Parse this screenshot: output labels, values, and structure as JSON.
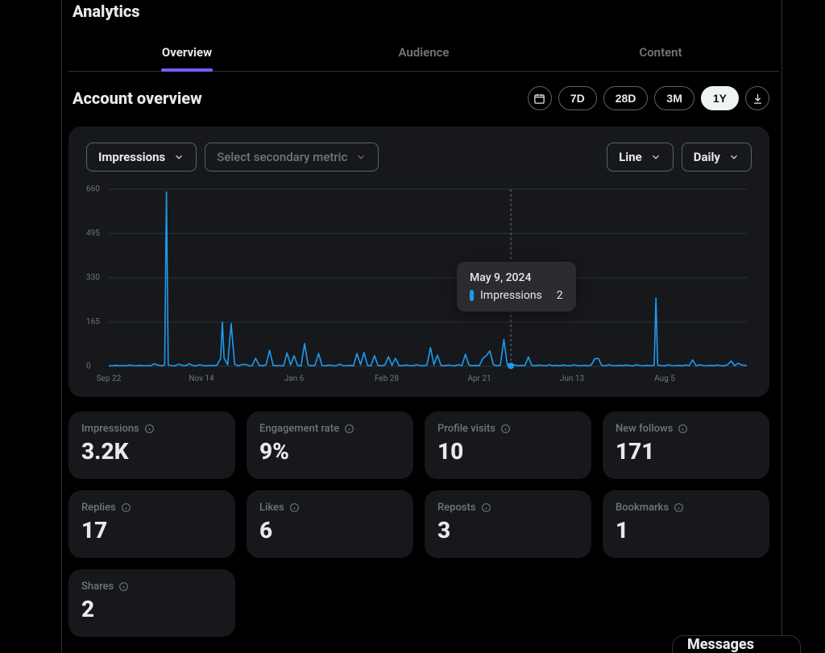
{
  "page_title": "Analytics",
  "tabs": {
    "overview": "Overview",
    "audience": "Audience",
    "content": "Content",
    "active": "overview"
  },
  "section_title": "Account overview",
  "date_ranges": [
    "7D",
    "28D",
    "3M",
    "1Y"
  ],
  "date_range_active": "1Y",
  "metric_selector": {
    "label": "Impressions"
  },
  "secondary_selector": {
    "placeholder": "Select secondary metric"
  },
  "chart_type": {
    "label": "Line"
  },
  "granularity": {
    "label": "Daily"
  },
  "tooltip": {
    "date": "May 9, 2024",
    "metric": "Impressions",
    "value": "2"
  },
  "stats": {
    "impressions": {
      "label": "Impressions",
      "value": "3.2K"
    },
    "engagement_rate": {
      "label": "Engagement rate",
      "value": "9%"
    },
    "profile_visits": {
      "label": "Profile visits",
      "value": "10"
    },
    "new_follows": {
      "label": "New follows",
      "value": "171"
    },
    "replies": {
      "label": "Replies",
      "value": "17"
    },
    "likes": {
      "label": "Likes",
      "value": "6"
    },
    "reposts": {
      "label": "Reposts",
      "value": "3"
    },
    "bookmarks": {
      "label": "Bookmarks",
      "value": "1"
    },
    "shares": {
      "label": "Shares",
      "value": "2"
    }
  },
  "messages_label": "Messages",
  "chart_data": {
    "type": "line",
    "title": "",
    "xlabel": "",
    "ylabel": "",
    "ylim": [
      0,
      660
    ],
    "y_ticks": [
      0,
      165,
      330,
      495,
      660
    ],
    "x_tick_labels": [
      "Sep 22",
      "Nov 14",
      "Jan 6",
      "Feb 28",
      "Apr 21",
      "Jun 13",
      "Aug 5"
    ],
    "x_tick_positions": [
      0,
      53,
      106,
      159,
      212,
      265,
      318
    ],
    "x_range": [
      0,
      365
    ],
    "hover_index": 230,
    "series": [
      {
        "name": "Impressions",
        "color": "#1d9bf0",
        "x": [
          0,
          2,
          4,
          6,
          8,
          10,
          12,
          14,
          16,
          18,
          20,
          22,
          24,
          26,
          28,
          30,
          32,
          33,
          34,
          36,
          38,
          40,
          42,
          44,
          46,
          48,
          50,
          52,
          54,
          56,
          58,
          60,
          62,
          64,
          65,
          66,
          68,
          70,
          72,
          74,
          76,
          78,
          80,
          82,
          84,
          86,
          88,
          90,
          92,
          94,
          96,
          98,
          100,
          102,
          104,
          106,
          108,
          110,
          112,
          114,
          116,
          118,
          120,
          122,
          124,
          126,
          128,
          130,
          132,
          134,
          136,
          138,
          140,
          142,
          144,
          146,
          148,
          150,
          152,
          154,
          156,
          158,
          160,
          162,
          164,
          166,
          168,
          170,
          172,
          174,
          176,
          178,
          180,
          182,
          184,
          186,
          188,
          190,
          192,
          194,
          196,
          198,
          200,
          202,
          204,
          206,
          208,
          210,
          212,
          214,
          216,
          218,
          220,
          222,
          224,
          226,
          228,
          230,
          232,
          234,
          236,
          238,
          240,
          242,
          244,
          246,
          248,
          250,
          252,
          254,
          256,
          258,
          260,
          262,
          264,
          266,
          268,
          270,
          272,
          274,
          276,
          278,
          280,
          282,
          284,
          286,
          288,
          290,
          292,
          294,
          296,
          298,
          300,
          302,
          304,
          306,
          308,
          310,
          312,
          313,
          314,
          316,
          318,
          320,
          322,
          324,
          326,
          328,
          330,
          332,
          334,
          336,
          338,
          340,
          342,
          344,
          346,
          348,
          350,
          352,
          354,
          356,
          358,
          360,
          362,
          365
        ],
        "values": [
          2,
          2,
          4,
          2,
          3,
          2,
          5,
          3,
          2,
          4,
          2,
          3,
          2,
          10,
          5,
          2,
          5,
          650,
          5,
          3,
          2,
          8,
          4,
          2,
          10,
          3,
          2,
          6,
          3,
          2,
          4,
          2,
          5,
          30,
          165,
          30,
          6,
          160,
          8,
          2,
          6,
          8,
          3,
          2,
          30,
          4,
          2,
          6,
          60,
          4,
          2,
          3,
          2,
          50,
          5,
          40,
          4,
          2,
          85,
          6,
          2,
          4,
          48,
          3,
          2,
          5,
          3,
          2,
          8,
          3,
          2,
          4,
          2,
          48,
          6,
          52,
          4,
          2,
          40,
          3,
          2,
          5,
          36,
          4,
          30,
          3,
          2,
          5,
          3,
          2,
          6,
          3,
          2,
          5,
          70,
          6,
          42,
          4,
          2,
          5,
          3,
          2,
          6,
          3,
          45,
          5,
          2,
          4,
          2,
          30,
          40,
          58,
          6,
          2,
          4,
          100,
          5,
          2,
          6,
          2,
          4,
          2,
          35,
          4,
          2,
          5,
          3,
          2,
          6,
          2,
          4,
          2,
          5,
          3,
          2,
          6,
          3,
          2,
          4,
          2,
          5,
          28,
          30,
          3,
          2,
          6,
          3,
          2,
          4,
          2,
          5,
          3,
          2,
          6,
          3,
          2,
          4,
          2,
          5,
          255,
          5,
          3,
          2,
          6,
          3,
          2,
          4,
          2,
          5,
          3,
          24,
          2,
          6,
          3,
          2,
          4,
          2,
          5,
          3,
          2,
          6,
          20,
          2,
          12,
          5,
          3
        ]
      }
    ]
  }
}
